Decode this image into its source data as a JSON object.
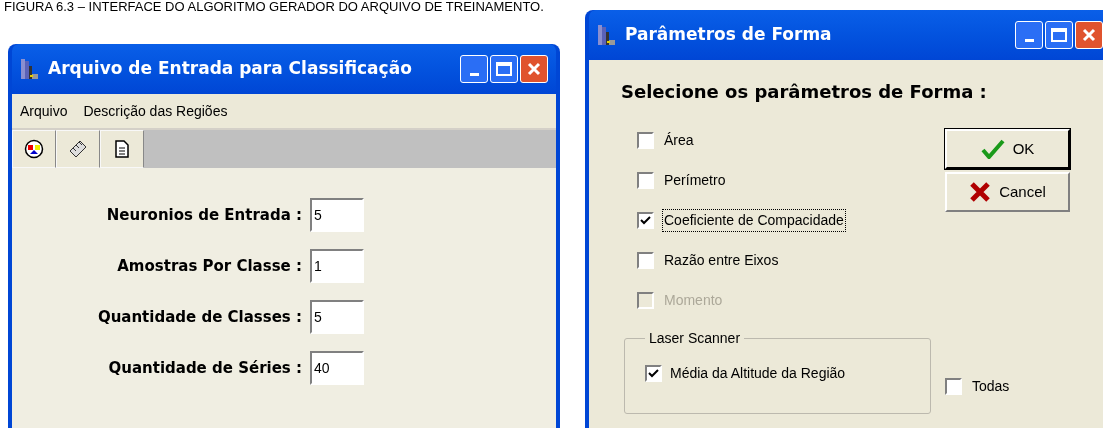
{
  "caption": "FIGURA 6.3 – INTERFACE DO ALGORITMO GERADOR DO ARQUIVO DE TREINAMENTO.",
  "windows": [
    {
      "title": "Arquivo de Entrada para Classificação",
      "menu": [
        {
          "label": "Arquivo"
        },
        {
          "label": "Descrição das Regiões"
        }
      ],
      "toolbar": [
        {
          "kind": "palette"
        },
        {
          "kind": "ruler"
        },
        {
          "kind": "document"
        }
      ],
      "fields": [
        {
          "label": "Neuronios de Entrada :",
          "value": "5"
        },
        {
          "label": "Amostras Por Classe :",
          "value": "1"
        },
        {
          "label": "Quantidade de Classes :",
          "value": "5"
        },
        {
          "label": "Quantidade de Séries :",
          "value": "40"
        }
      ]
    },
    {
      "title": "Parâmetros de Forma",
      "heading": "Selecione os parâmetros de Forma :",
      "options": [
        {
          "label": "Área",
          "checked": false,
          "disabled": false,
          "focused": false
        },
        {
          "label": "Perímetro",
          "checked": false,
          "disabled": false,
          "focused": false
        },
        {
          "label": "Coeficiente de Compacidade",
          "checked": true,
          "disabled": false,
          "focused": true
        },
        {
          "label": "Razão entre Eixos",
          "checked": false,
          "disabled": false,
          "focused": false
        },
        {
          "label": "Momento",
          "checked": false,
          "disabled": true,
          "focused": false
        }
      ],
      "buttons": [
        {
          "kind": "ok",
          "label": "OK",
          "default": true
        },
        {
          "kind": "cancel",
          "label": "Cancel",
          "default": false
        }
      ],
      "group": {
        "title": "Laser Scanner",
        "options": [
          {
            "label": "Média da Altitude da Região",
            "checked": true
          }
        ]
      },
      "extra_option": {
        "label": "Todas",
        "checked": false
      }
    }
  ]
}
